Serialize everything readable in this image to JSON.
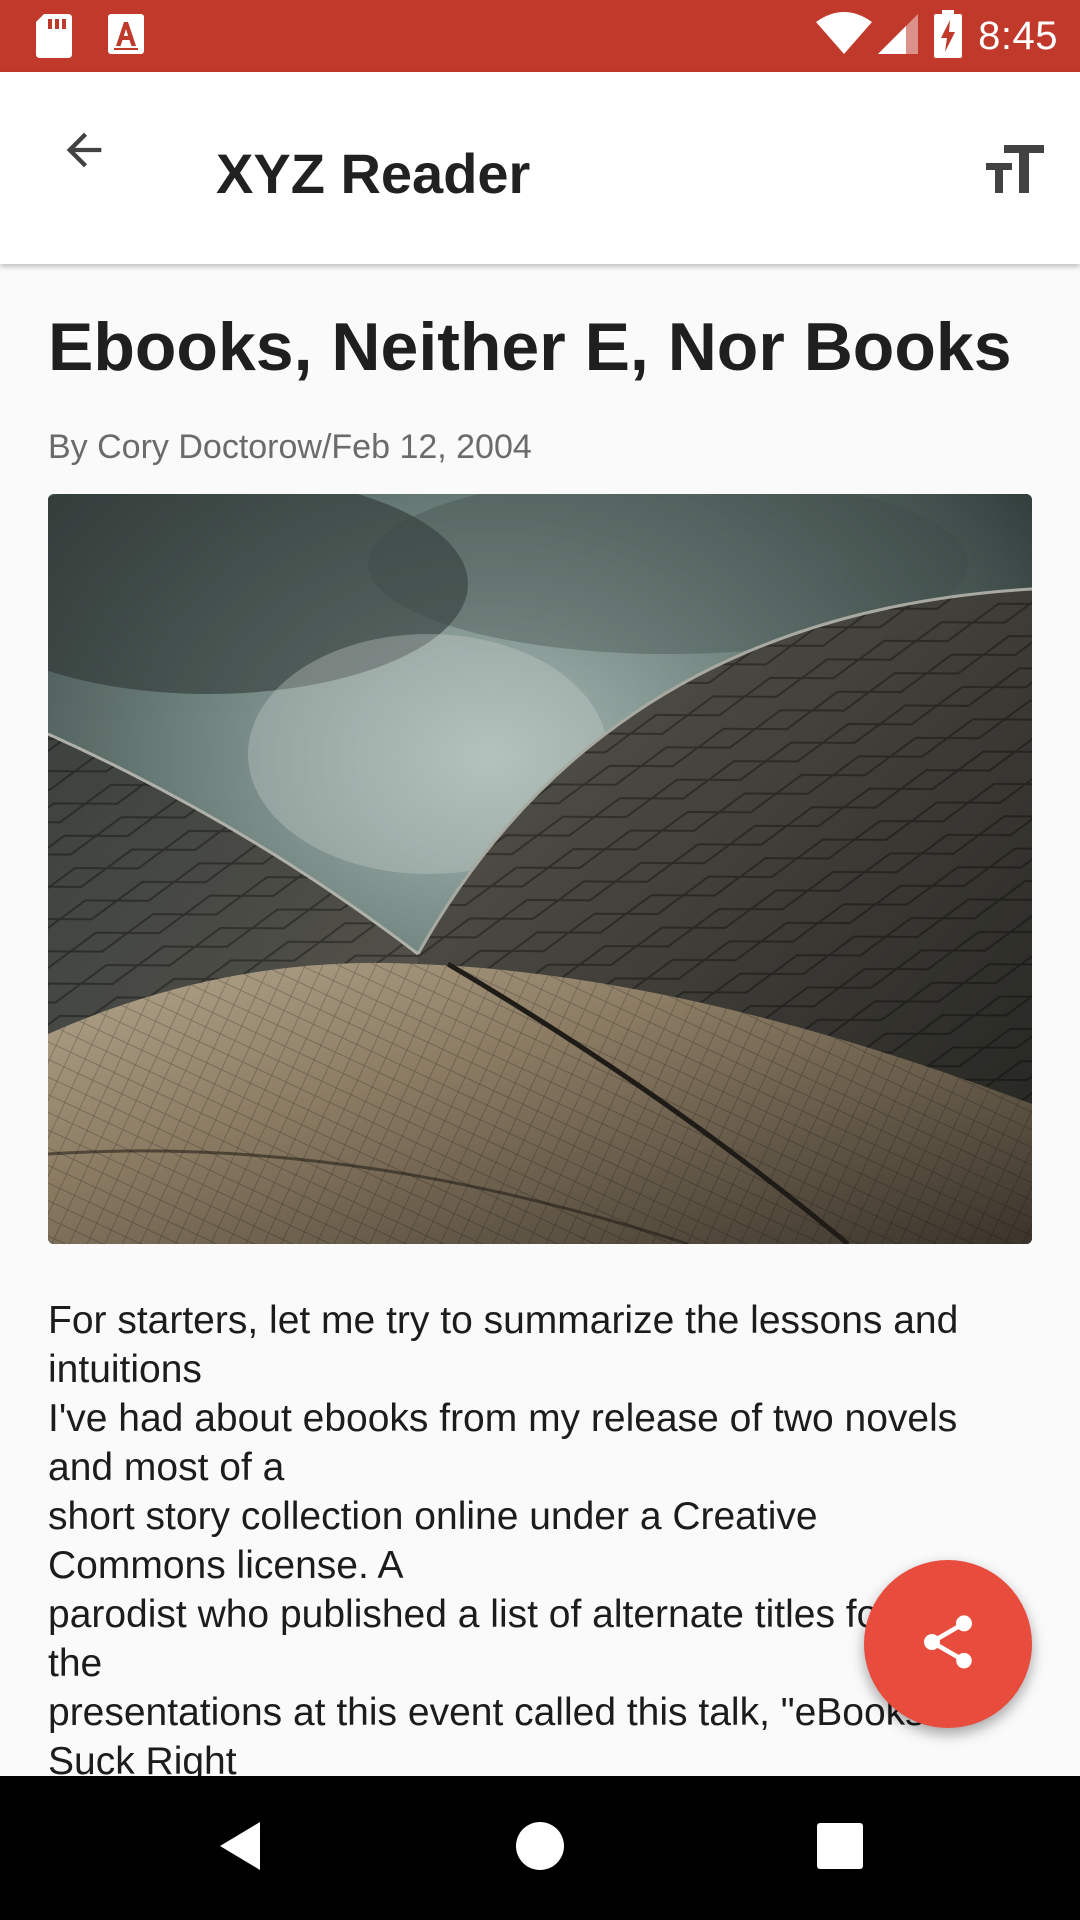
{
  "status_bar": {
    "time": "8:45",
    "left_icons": [
      "sd-card-icon",
      "font-a-icon"
    ],
    "right_icons": [
      "wifi-icon",
      "cell-signal-icon",
      "battery-charging-icon"
    ],
    "background_color": "#c0392b"
  },
  "app_bar": {
    "title": "XYZ Reader",
    "back_icon": "arrow-back-icon",
    "action_icon": "text-size-icon"
  },
  "article": {
    "title": "Ebooks, Neither E, Nor Books",
    "byline": "By Cory Doctorow/Feb 12, 2004",
    "image_subject": "tiled curved roof shells under cloudy sky",
    "body_lines": [
      "For starters, let me try to summarize the lessons and",
      "intuitions",
      "I've had about ebooks from my release of two novels",
      "and most of a",
      "short story collection online under a Creative",
      "Commons license. A",
      "parodist who published a list of alternate titles for",
      "the",
      "presentations at this event called this talk, \"eBooks",
      "Suck Right"
    ]
  },
  "fab": {
    "icon": "share-icon",
    "color": "#e74c3c"
  },
  "nav_bar": {
    "buttons": [
      "nav-back-icon",
      "nav-home-icon",
      "nav-recents-icon"
    ]
  }
}
